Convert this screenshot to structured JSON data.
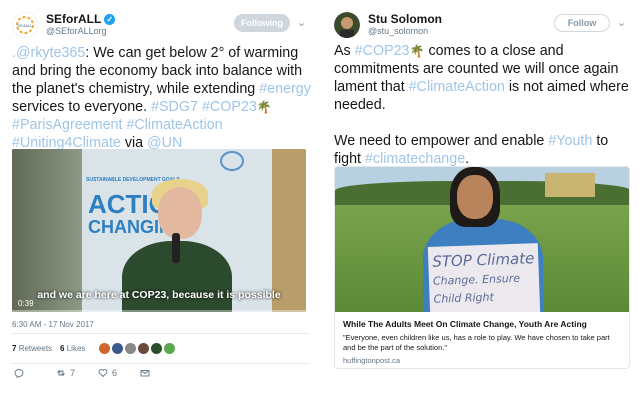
{
  "left_tweet": {
    "display_name": "SEforALL",
    "handle": "@SEforALLorg",
    "avatar_icon": "seforall-logo",
    "follow_label": "Following",
    "text_parts": [
      {
        "t": "mention",
        "v": ".@rkyte365"
      },
      {
        "t": "text",
        "v": ": We can get below 2° of warming and bring the economy back into balance with the planet's chemistry, while extending "
      },
      {
        "t": "tag",
        "v": "#energy"
      },
      {
        "t": "text",
        "v": " services to everyone. "
      },
      {
        "t": "tag",
        "v": "#SDG7"
      },
      {
        "t": "text",
        "v": " "
      },
      {
        "t": "tag",
        "v": "#COP23"
      },
      {
        "t": "emoji",
        "v": "🌴"
      },
      {
        "t": "text",
        "v": " "
      },
      {
        "t": "tag",
        "v": "#ParisAgreement"
      },
      {
        "t": "text",
        "v": " "
      },
      {
        "t": "tag",
        "v": "#ClimateAction"
      },
      {
        "t": "text",
        "v": " "
      },
      {
        "t": "tag",
        "v": "#Uniting4Climate"
      },
      {
        "t": "text",
        "v": " via "
      },
      {
        "t": "mention",
        "v": "@UN"
      }
    ],
    "video": {
      "board_line1": "SUSTAINABLE DEVELOPMENT GOALS",
      "board_line2": "ACTION",
      "board_line3": "CHANGING",
      "subtitle": "and we are here at COP23, because it is possible",
      "time": "0:39"
    },
    "timestamp": "6:30 AM - 17 Nov 2017",
    "retweets_count": "7",
    "retweets_label": "Retweets",
    "likes_count": "6",
    "likes_label": "Likes",
    "liker_colors": [
      "#d0662c",
      "#3a5a8c",
      "#888888",
      "#6b4a3a",
      "#2b4e2b",
      "#59a94f"
    ],
    "actions": {
      "reply": "",
      "retweet": "7",
      "like": "6",
      "dm": ""
    }
  },
  "right_tweet": {
    "display_name": "Stu Solomon",
    "handle": "@stu_solomon",
    "follow_label": "Follow",
    "text_parts": [
      {
        "t": "text",
        "v": "As "
      },
      {
        "t": "tag",
        "v": "#COP23"
      },
      {
        "t": "emoji",
        "v": "🌴"
      },
      {
        "t": "text",
        "v": " comes to a close and commitments are counted we will once again lament that "
      },
      {
        "t": "tag",
        "v": "#ClimateAction"
      },
      {
        "t": "text",
        "v": " is not aimed where needed."
      },
      {
        "t": "br",
        "v": ""
      },
      {
        "t": "br",
        "v": ""
      },
      {
        "t": "text",
        "v": "We need to empower and enable "
      },
      {
        "t": "tag",
        "v": "#Youth"
      },
      {
        "t": "text",
        "v": " to fight "
      },
      {
        "t": "tag",
        "v": "#climatechange"
      },
      {
        "t": "text",
        "v": "."
      }
    ],
    "card": {
      "sign_line1": "STOP Climate",
      "sign_line2": "Change. Ensure",
      "sign_line3": "Child Right",
      "title": "While The Adults Meet On Climate Change, Youth Are Acting",
      "description": "\"Everyone, even children like us, has a role to play. We have chosen to take part and be the part of the solution.\"",
      "domain": "huffingtonpost.ca"
    }
  },
  "colors": {
    "hashtag": "#9fc5e6",
    "verified": "#1da1f2",
    "following_bg": "#cfd6dc",
    "muted_text": "#657786"
  }
}
